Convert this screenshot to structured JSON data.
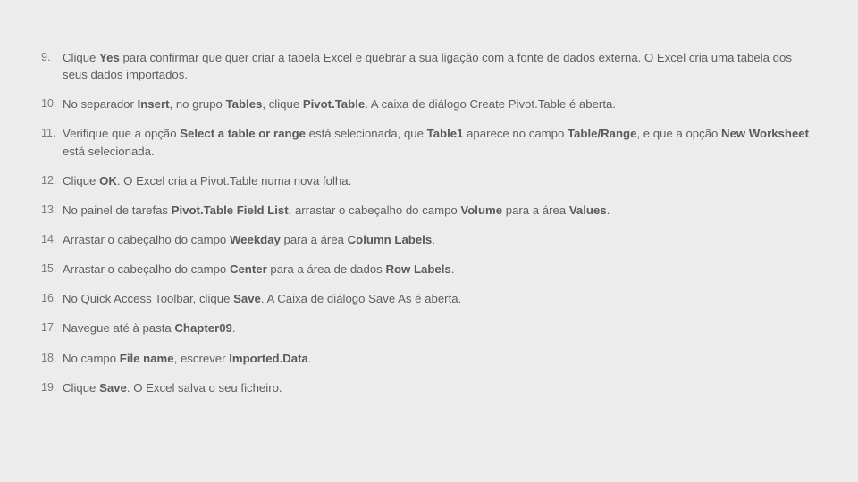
{
  "steps": [
    {
      "segments": [
        {
          "t": "Clique "
        },
        {
          "t": "Yes",
          "b": true
        },
        {
          "t": " para confirmar que quer criar a tabela Excel e quebrar a sua ligação com a fonte de dados externa. O Excel cria uma tabela dos seus dados importados."
        }
      ]
    },
    {
      "segments": [
        {
          "t": "No separador "
        },
        {
          "t": "Insert",
          "b": true
        },
        {
          "t": ", no grupo "
        },
        {
          "t": "Tables",
          "b": true
        },
        {
          "t": ", clique "
        },
        {
          "t": "Pivot.Table",
          "b": true
        },
        {
          "t": ". A caixa de diálogo Create Pivot.Table é aberta."
        }
      ]
    },
    {
      "segments": [
        {
          "t": "Verifique que a opção "
        },
        {
          "t": "Select a table or range",
          "b": true
        },
        {
          "t": " está selecionada, que "
        },
        {
          "t": "Table1",
          "b": true
        },
        {
          "t": " aparece no campo "
        },
        {
          "t": "Table/Range",
          "b": true
        },
        {
          "t": ", e que a opção "
        },
        {
          "t": "New Worksheet",
          "b": true
        },
        {
          "t": " está selecionada."
        }
      ]
    },
    {
      "segments": [
        {
          "t": "Clique "
        },
        {
          "t": "OK",
          "b": true
        },
        {
          "t": ". O Excel cria a Pivot.Table numa nova folha."
        }
      ]
    },
    {
      "segments": [
        {
          "t": "No painel de tarefas "
        },
        {
          "t": "Pivot.Table Field List",
          "b": true
        },
        {
          "t": ", arrastar o cabeçalho do campo "
        },
        {
          "t": "Volume",
          "b": true
        },
        {
          "t": " para a área "
        },
        {
          "t": "Values",
          "b": true
        },
        {
          "t": "."
        }
      ]
    },
    {
      "segments": [
        {
          "t": "Arrastar o cabeçalho do campo "
        },
        {
          "t": "Weekday",
          "b": true
        },
        {
          "t": " para a área "
        },
        {
          "t": "Column Labels",
          "b": true
        },
        {
          "t": "."
        }
      ]
    },
    {
      "segments": [
        {
          "t": "Arrastar o cabeçalho do campo "
        },
        {
          "t": "Center",
          "b": true
        },
        {
          "t": " para a área de dados "
        },
        {
          "t": "Row Labels",
          "b": true
        },
        {
          "t": "."
        }
      ]
    },
    {
      "segments": [
        {
          "t": "No Quick Access Toolbar, clique "
        },
        {
          "t": "Save",
          "b": true
        },
        {
          "t": ". A Caixa de diálogo Save As é aberta."
        }
      ]
    },
    {
      "segments": [
        {
          "t": "Navegue até à pasta "
        },
        {
          "t": "Chapter09",
          "b": true
        },
        {
          "t": "."
        }
      ]
    },
    {
      "segments": [
        {
          "t": "No campo "
        },
        {
          "t": "File name",
          "b": true
        },
        {
          "t": ", escrever "
        },
        {
          "t": "Imported.Data",
          "b": true
        },
        {
          "t": "."
        }
      ]
    },
    {
      "segments": [
        {
          "t": "Clique "
        },
        {
          "t": "Save",
          "b": true
        },
        {
          "t": ". O Excel salva o seu ficheiro."
        }
      ]
    }
  ]
}
